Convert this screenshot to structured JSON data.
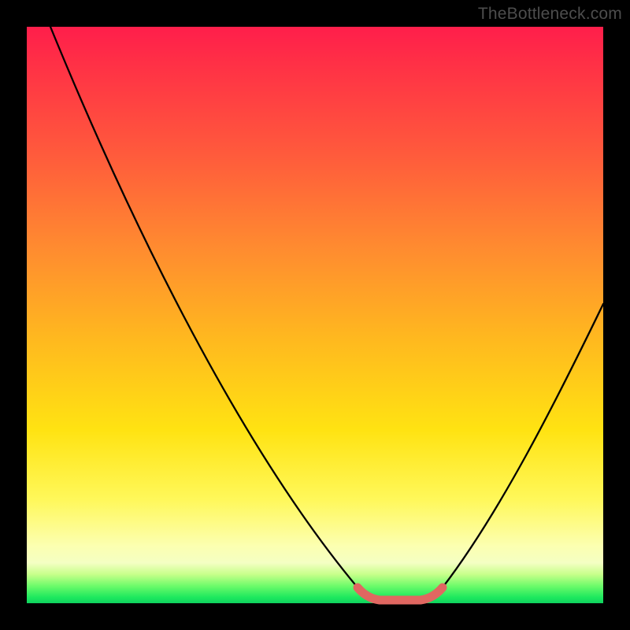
{
  "watermark": "TheBottleneck.com",
  "chart_data": {
    "type": "line",
    "title": "",
    "xlabel": "",
    "ylabel": "",
    "xlim": [
      0,
      1
    ],
    "ylim": [
      0,
      1
    ],
    "series": [
      {
        "name": "black-curve",
        "x": [
          0.0,
          0.07,
          0.14,
          0.21,
          0.28,
          0.35,
          0.42,
          0.49,
          0.56,
          0.6
        ],
        "values": [
          1.0,
          0.88,
          0.76,
          0.63,
          0.5,
          0.38,
          0.26,
          0.14,
          0.04,
          0.0
        ]
      },
      {
        "name": "black-curve-right",
        "x": [
          0.7,
          0.76,
          0.82,
          0.88,
          0.94,
          1.0
        ],
        "values": [
          0.0,
          0.09,
          0.19,
          0.3,
          0.41,
          0.52
        ]
      },
      {
        "name": "red-highlight",
        "x": [
          0.58,
          0.6,
          0.63,
          0.67,
          0.7,
          0.72
        ],
        "values": [
          0.03,
          0.01,
          0.0,
          0.0,
          0.01,
          0.03
        ]
      }
    ],
    "background_gradient": {
      "top": "#ff1e4b",
      "mid": "#ffe312",
      "bottom": "#0fd25e"
    }
  }
}
